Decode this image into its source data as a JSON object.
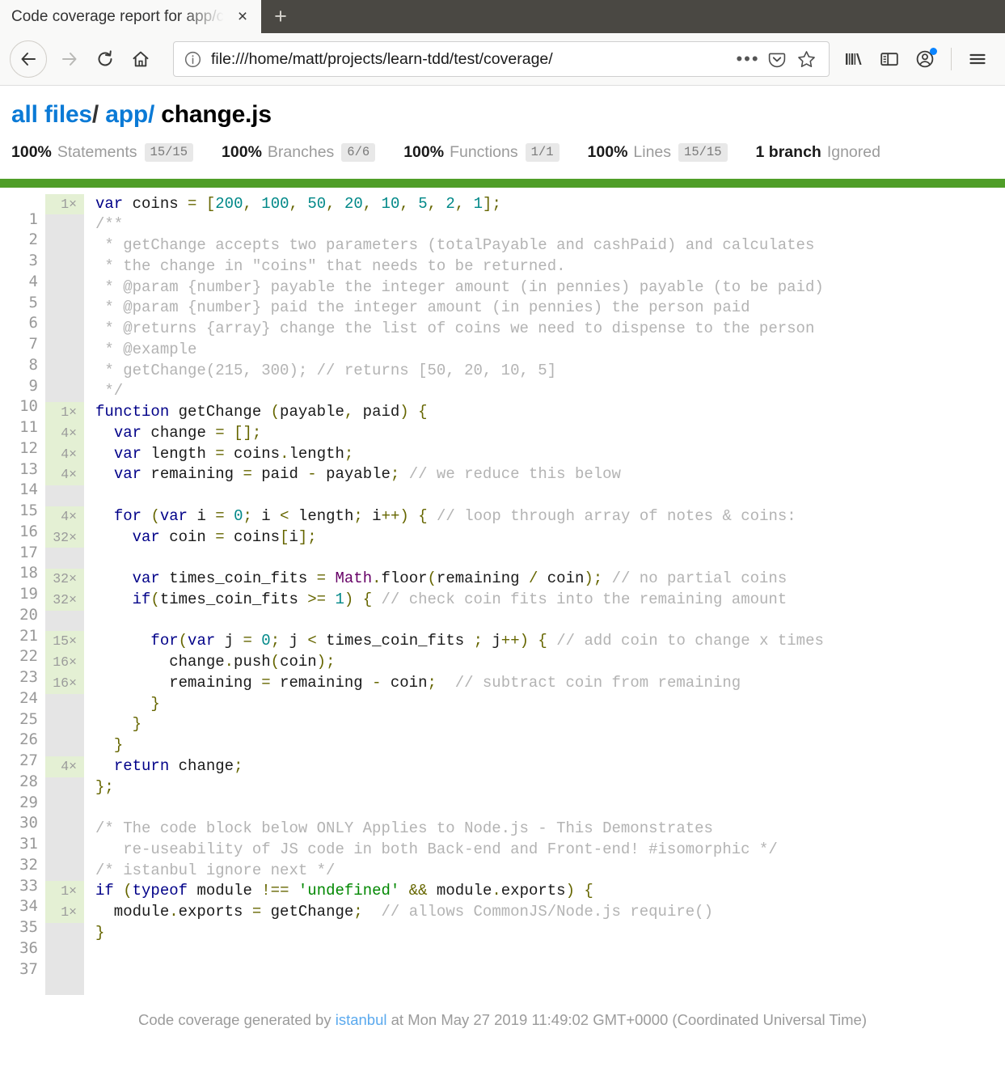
{
  "browser": {
    "tab": {
      "title": "Code coverage report for app/change.js",
      "close_label": "×"
    },
    "newtab_label": "+",
    "nav": {
      "back_label": "←",
      "forward_label": "→",
      "reload_label": "⟳",
      "home_label": "⌂"
    },
    "url": "file:///home/matt/projects/learn-tdd/test/coverage/",
    "url_actions": {
      "page_actions_label": "•••",
      "pocket_label": "pocket",
      "bookmark_label": "☆"
    },
    "toolbar": {
      "library_label": "library",
      "sidebar_label": "sidebar",
      "account_label": "account",
      "menu_label": "☰"
    },
    "accent_color": "#0a84ff",
    "chrome_dark": "#4a4843",
    "chrome_light": "#f9f9f8"
  },
  "report": {
    "breadcrumb": {
      "root": "all files",
      "separator": "/",
      "folder": "app/",
      "file": "change.js"
    },
    "summary": [
      {
        "pct": "100%",
        "label": "Statements",
        "fraction": "15/15"
      },
      {
        "pct": "100%",
        "label": "Branches",
        "fraction": "6/6"
      },
      {
        "pct": "100%",
        "label": "Functions",
        "fraction": "1/1"
      },
      {
        "pct": "100%",
        "label": "Lines",
        "fraction": "15/15"
      }
    ],
    "ignored": {
      "count": "1 branch",
      "label": "Ignored"
    },
    "status_color": "#4f9e28",
    "footer": {
      "prefix": "Code coverage generated by",
      "tool": "istanbul",
      "suffix": "at Mon May 27 2019 11:49:02 GMT+0000 (Coordinated Universal Time)"
    }
  },
  "code": {
    "line_numbers": "1\n2\n3\n4\n5\n6\n7\n8\n9\n10\n11\n12\n13\n14\n15\n16\n17\n18\n19\n20\n21\n22\n23\n24\n25\n26\n27\n28\n29\n30\n31\n32\n33\n34\n35\n36\n37",
    "counts": [
      "1×",
      "",
      "",
      "",
      "",
      "",
      "",
      "",
      "",
      "",
      "1×",
      "4×",
      "4×",
      "4×",
      "",
      "4×",
      "32×",
      "",
      "32×",
      "32×",
      "",
      "15×",
      "16×",
      "16×",
      "",
      "",
      "",
      "4×",
      "",
      "",
      "",
      "",
      "",
      "1×",
      "1×",
      "",
      ""
    ],
    "counts_hit": [
      true,
      false,
      false,
      false,
      false,
      false,
      false,
      false,
      false,
      false,
      true,
      true,
      true,
      true,
      false,
      true,
      true,
      false,
      true,
      true,
      false,
      true,
      true,
      true,
      false,
      false,
      false,
      true,
      false,
      false,
      false,
      false,
      false,
      true,
      true,
      false,
      false
    ],
    "lines": [
      "var coins = [200, 100, 50, 20, 10, 5, 2, 1];",
      "/**",
      " * getChange accepts two parameters (totalPayable and cashPaid) and calculates",
      " * the change in \"coins\" that needs to be returned.",
      " * @param {number} payable the integer amount (in pennies) payable (to be paid)",
      " * @param {number} paid the integer amount (in pennies) the person paid",
      " * @returns {array} change the list of coins we need to dispense to the person",
      " * @example",
      " * getChange(215, 300); // returns [50, 20, 10, 5]",
      " */",
      "function getChange (payable, paid) {",
      "  var change = [];",
      "  var length = coins.length;",
      "  var remaining = paid - payable; // we reduce this below",
      "",
      "  for (var i = 0; i < length; i++) { // loop through array of notes & coins:",
      "    var coin = coins[i];",
      "",
      "    var times_coin_fits = Math.floor(remaining / coin); // no partial coins",
      "    if(times_coin_fits >= 1) { // check coin fits into the remaining amount",
      "",
      "      for(var j = 0; j < times_coin_fits ; j++) { // add coin to change x times",
      "        change.push(coin);",
      "        remaining = remaining - coin;  // subtract coin from remaining",
      "      }",
      "    }",
      "  }",
      "  return change;",
      "};",
      "",
      "/* The code block below ONLY Applies to Node.js - This Demonstrates",
      "   re-useability of JS code in both Back-end and Front-end! #isomorphic */",
      "/* istanbul ignore next */",
      "if (typeof module !== 'undefined' && module.exports) {",
      "  module.exports = getChange;  // allows CommonJS/Node.js require()",
      "}",
      ""
    ],
    "tokens": [
      [
        [
          "t-kw",
          "var"
        ],
        [
          "t-pln",
          " coins "
        ],
        [
          "t-pun",
          "="
        ],
        [
          "t-pln",
          " "
        ],
        [
          "t-pun",
          "["
        ],
        [
          "t-num",
          "200"
        ],
        [
          "t-pun",
          ","
        ],
        [
          "t-pln",
          " "
        ],
        [
          "t-num",
          "100"
        ],
        [
          "t-pun",
          ","
        ],
        [
          "t-pln",
          " "
        ],
        [
          "t-num",
          "50"
        ],
        [
          "t-pun",
          ","
        ],
        [
          "t-pln",
          " "
        ],
        [
          "t-num",
          "20"
        ],
        [
          "t-pun",
          ","
        ],
        [
          "t-pln",
          " "
        ],
        [
          "t-num",
          "10"
        ],
        [
          "t-pun",
          ","
        ],
        [
          "t-pln",
          " "
        ],
        [
          "t-num",
          "5"
        ],
        [
          "t-pun",
          ","
        ],
        [
          "t-pln",
          " "
        ],
        [
          "t-num",
          "2"
        ],
        [
          "t-pun",
          ","
        ],
        [
          "t-pln",
          " "
        ],
        [
          "t-num",
          "1"
        ],
        [
          "t-pun",
          "];"
        ]
      ],
      [
        [
          "t-com",
          "/**"
        ]
      ],
      [
        [
          "t-com",
          " * getChange accepts two parameters (totalPayable and cashPaid) and calculates"
        ]
      ],
      [
        [
          "t-com",
          " * the change in \"coins\" that needs to be returned."
        ]
      ],
      [
        [
          "t-com",
          " * @param {number} payable the integer amount (in pennies) payable (to be paid)"
        ]
      ],
      [
        [
          "t-com",
          " * @param {number} paid the integer amount (in pennies) the person paid"
        ]
      ],
      [
        [
          "t-com",
          " * @returns {array} change the list of coins we need to dispense to the person"
        ]
      ],
      [
        [
          "t-com",
          " * @example"
        ]
      ],
      [
        [
          "t-com",
          " * getChange(215, 300); // returns [50, 20, 10, 5]"
        ]
      ],
      [
        [
          "t-com",
          " */"
        ]
      ],
      [
        [
          "t-kw",
          "function"
        ],
        [
          "t-pln",
          " getChange "
        ],
        [
          "t-pun",
          "("
        ],
        [
          "t-pln",
          "payable"
        ],
        [
          "t-pun",
          ","
        ],
        [
          "t-pln",
          " paid"
        ],
        [
          "t-pun",
          ")"
        ],
        [
          "t-pln",
          " "
        ],
        [
          "t-pun",
          "{"
        ]
      ],
      [
        [
          "t-pln",
          "  "
        ],
        [
          "t-kw",
          "var"
        ],
        [
          "t-pln",
          " change "
        ],
        [
          "t-pun",
          "="
        ],
        [
          "t-pln",
          " "
        ],
        [
          "t-pun",
          "[];"
        ]
      ],
      [
        [
          "t-pln",
          "  "
        ],
        [
          "t-kw",
          "var"
        ],
        [
          "t-pln",
          " length "
        ],
        [
          "t-pun",
          "="
        ],
        [
          "t-pln",
          " coins"
        ],
        [
          "t-pun",
          "."
        ],
        [
          "t-pln",
          "length"
        ],
        [
          "t-pun",
          ";"
        ]
      ],
      [
        [
          "t-pln",
          "  "
        ],
        [
          "t-kw",
          "var"
        ],
        [
          "t-pln",
          " remaining "
        ],
        [
          "t-pun",
          "="
        ],
        [
          "t-pln",
          " paid "
        ],
        [
          "t-pun",
          "-"
        ],
        [
          "t-pln",
          " payable"
        ],
        [
          "t-pun",
          ";"
        ],
        [
          "t-pln",
          " "
        ],
        [
          "t-com",
          "// we reduce this below"
        ]
      ],
      [
        [
          "t-pln",
          ""
        ]
      ],
      [
        [
          "t-pln",
          "  "
        ],
        [
          "t-kw",
          "for"
        ],
        [
          "t-pln",
          " "
        ],
        [
          "t-pun",
          "("
        ],
        [
          "t-kw",
          "var"
        ],
        [
          "t-pln",
          " i "
        ],
        [
          "t-pun",
          "="
        ],
        [
          "t-pln",
          " "
        ],
        [
          "t-num",
          "0"
        ],
        [
          "t-pun",
          ";"
        ],
        [
          "t-pln",
          " i "
        ],
        [
          "t-pun",
          "<"
        ],
        [
          "t-pln",
          " length"
        ],
        [
          "t-pun",
          ";"
        ],
        [
          "t-pln",
          " i"
        ],
        [
          "t-pun",
          "++)"
        ],
        [
          "t-pln",
          " "
        ],
        [
          "t-pun",
          "{"
        ],
        [
          "t-pln",
          " "
        ],
        [
          "t-com",
          "// loop through array of notes & coins:"
        ]
      ],
      [
        [
          "t-pln",
          "    "
        ],
        [
          "t-kw",
          "var"
        ],
        [
          "t-pln",
          " coin "
        ],
        [
          "t-pun",
          "="
        ],
        [
          "t-pln",
          " coins"
        ],
        [
          "t-pun",
          "["
        ],
        [
          "t-pln",
          "i"
        ],
        [
          "t-pun",
          "];"
        ]
      ],
      [
        [
          "t-pln",
          ""
        ]
      ],
      [
        [
          "t-pln",
          "    "
        ],
        [
          "t-kw",
          "var"
        ],
        [
          "t-pln",
          " times_coin_fits "
        ],
        [
          "t-pun",
          "="
        ],
        [
          "t-pln",
          " "
        ],
        [
          "t-typ",
          "Math"
        ],
        [
          "t-pun",
          "."
        ],
        [
          "t-pln",
          "floor"
        ],
        [
          "t-pun",
          "("
        ],
        [
          "t-pln",
          "remaining "
        ],
        [
          "t-pun",
          "/"
        ],
        [
          "t-pln",
          " coin"
        ],
        [
          "t-pun",
          ");"
        ],
        [
          "t-pln",
          " "
        ],
        [
          "t-com",
          "// no partial coins"
        ]
      ],
      [
        [
          "t-pln",
          "    "
        ],
        [
          "t-kw",
          "if"
        ],
        [
          "t-pun",
          "("
        ],
        [
          "t-pln",
          "times_coin_fits "
        ],
        [
          "t-pun",
          ">="
        ],
        [
          "t-pln",
          " "
        ],
        [
          "t-num",
          "1"
        ],
        [
          "t-pun",
          ")"
        ],
        [
          "t-pln",
          " "
        ],
        [
          "t-pun",
          "{"
        ],
        [
          "t-pln",
          " "
        ],
        [
          "t-com",
          "// check coin fits into the remaining amount"
        ]
      ],
      [
        [
          "t-pln",
          ""
        ]
      ],
      [
        [
          "t-pln",
          "      "
        ],
        [
          "t-kw",
          "for"
        ],
        [
          "t-pun",
          "("
        ],
        [
          "t-kw",
          "var"
        ],
        [
          "t-pln",
          " j "
        ],
        [
          "t-pun",
          "="
        ],
        [
          "t-pln",
          " "
        ],
        [
          "t-num",
          "0"
        ],
        [
          "t-pun",
          ";"
        ],
        [
          "t-pln",
          " j "
        ],
        [
          "t-pun",
          "<"
        ],
        [
          "t-pln",
          " times_coin_fits "
        ],
        [
          "t-pun",
          ";"
        ],
        [
          "t-pln",
          " j"
        ],
        [
          "t-pun",
          "++)"
        ],
        [
          "t-pln",
          " "
        ],
        [
          "t-pun",
          "{"
        ],
        [
          "t-pln",
          " "
        ],
        [
          "t-com",
          "// add coin to change x times"
        ]
      ],
      [
        [
          "t-pln",
          "        change"
        ],
        [
          "t-pun",
          "."
        ],
        [
          "t-pln",
          "push"
        ],
        [
          "t-pun",
          "("
        ],
        [
          "t-pln",
          "coin"
        ],
        [
          "t-pun",
          ");"
        ]
      ],
      [
        [
          "t-pln",
          "        remaining "
        ],
        [
          "t-pun",
          "="
        ],
        [
          "t-pln",
          " remaining "
        ],
        [
          "t-pun",
          "-"
        ],
        [
          "t-pln",
          " coin"
        ],
        [
          "t-pun",
          ";"
        ],
        [
          "t-pln",
          "  "
        ],
        [
          "t-com",
          "// subtract coin from remaining"
        ]
      ],
      [
        [
          "t-pln",
          "      "
        ],
        [
          "t-pun",
          "}"
        ]
      ],
      [
        [
          "t-pln",
          "    "
        ],
        [
          "t-pun",
          "}"
        ]
      ],
      [
        [
          "t-pln",
          "  "
        ],
        [
          "t-pun",
          "}"
        ]
      ],
      [
        [
          "t-pln",
          "  "
        ],
        [
          "t-kw",
          "return"
        ],
        [
          "t-pln",
          " change"
        ],
        [
          "t-pun",
          ";"
        ]
      ],
      [
        [
          "t-pun",
          "};"
        ]
      ],
      [
        [
          "t-pln",
          ""
        ]
      ],
      [
        [
          "t-com",
          "/* The code block below ONLY Applies to Node.js - This Demonstrates"
        ]
      ],
      [
        [
          "t-com",
          "   re-useability of JS code in both Back-end and Front-end! #isomorphic */"
        ]
      ],
      [
        [
          "t-com",
          "/* istanbul ignore next */"
        ]
      ],
      [
        [
          "t-kw",
          "if"
        ],
        [
          "t-pln",
          " "
        ],
        [
          "t-pun",
          "("
        ],
        [
          "t-kw",
          "typeof"
        ],
        [
          "t-pln",
          " module "
        ],
        [
          "t-pun",
          "!=="
        ],
        [
          "t-pln",
          " "
        ],
        [
          "t-str",
          "'undefined'"
        ],
        [
          "t-pln",
          " "
        ],
        [
          "t-pun",
          "&&"
        ],
        [
          "t-pln",
          " module"
        ],
        [
          "t-pun",
          "."
        ],
        [
          "t-pln",
          "exports"
        ],
        [
          "t-pun",
          ")"
        ],
        [
          "t-pln",
          " "
        ],
        [
          "t-pun",
          "{"
        ]
      ],
      [
        [
          "t-pln",
          "  module"
        ],
        [
          "t-pun",
          "."
        ],
        [
          "t-pln",
          "exports "
        ],
        [
          "t-pun",
          "="
        ],
        [
          "t-pln",
          " getChange"
        ],
        [
          "t-pun",
          ";"
        ],
        [
          "t-pln",
          "  "
        ],
        [
          "t-com",
          "// allows CommonJS/Node.js require()"
        ]
      ],
      [
        [
          "t-pun",
          "}"
        ]
      ],
      [
        [
          "t-pln",
          ""
        ]
      ]
    ]
  }
}
